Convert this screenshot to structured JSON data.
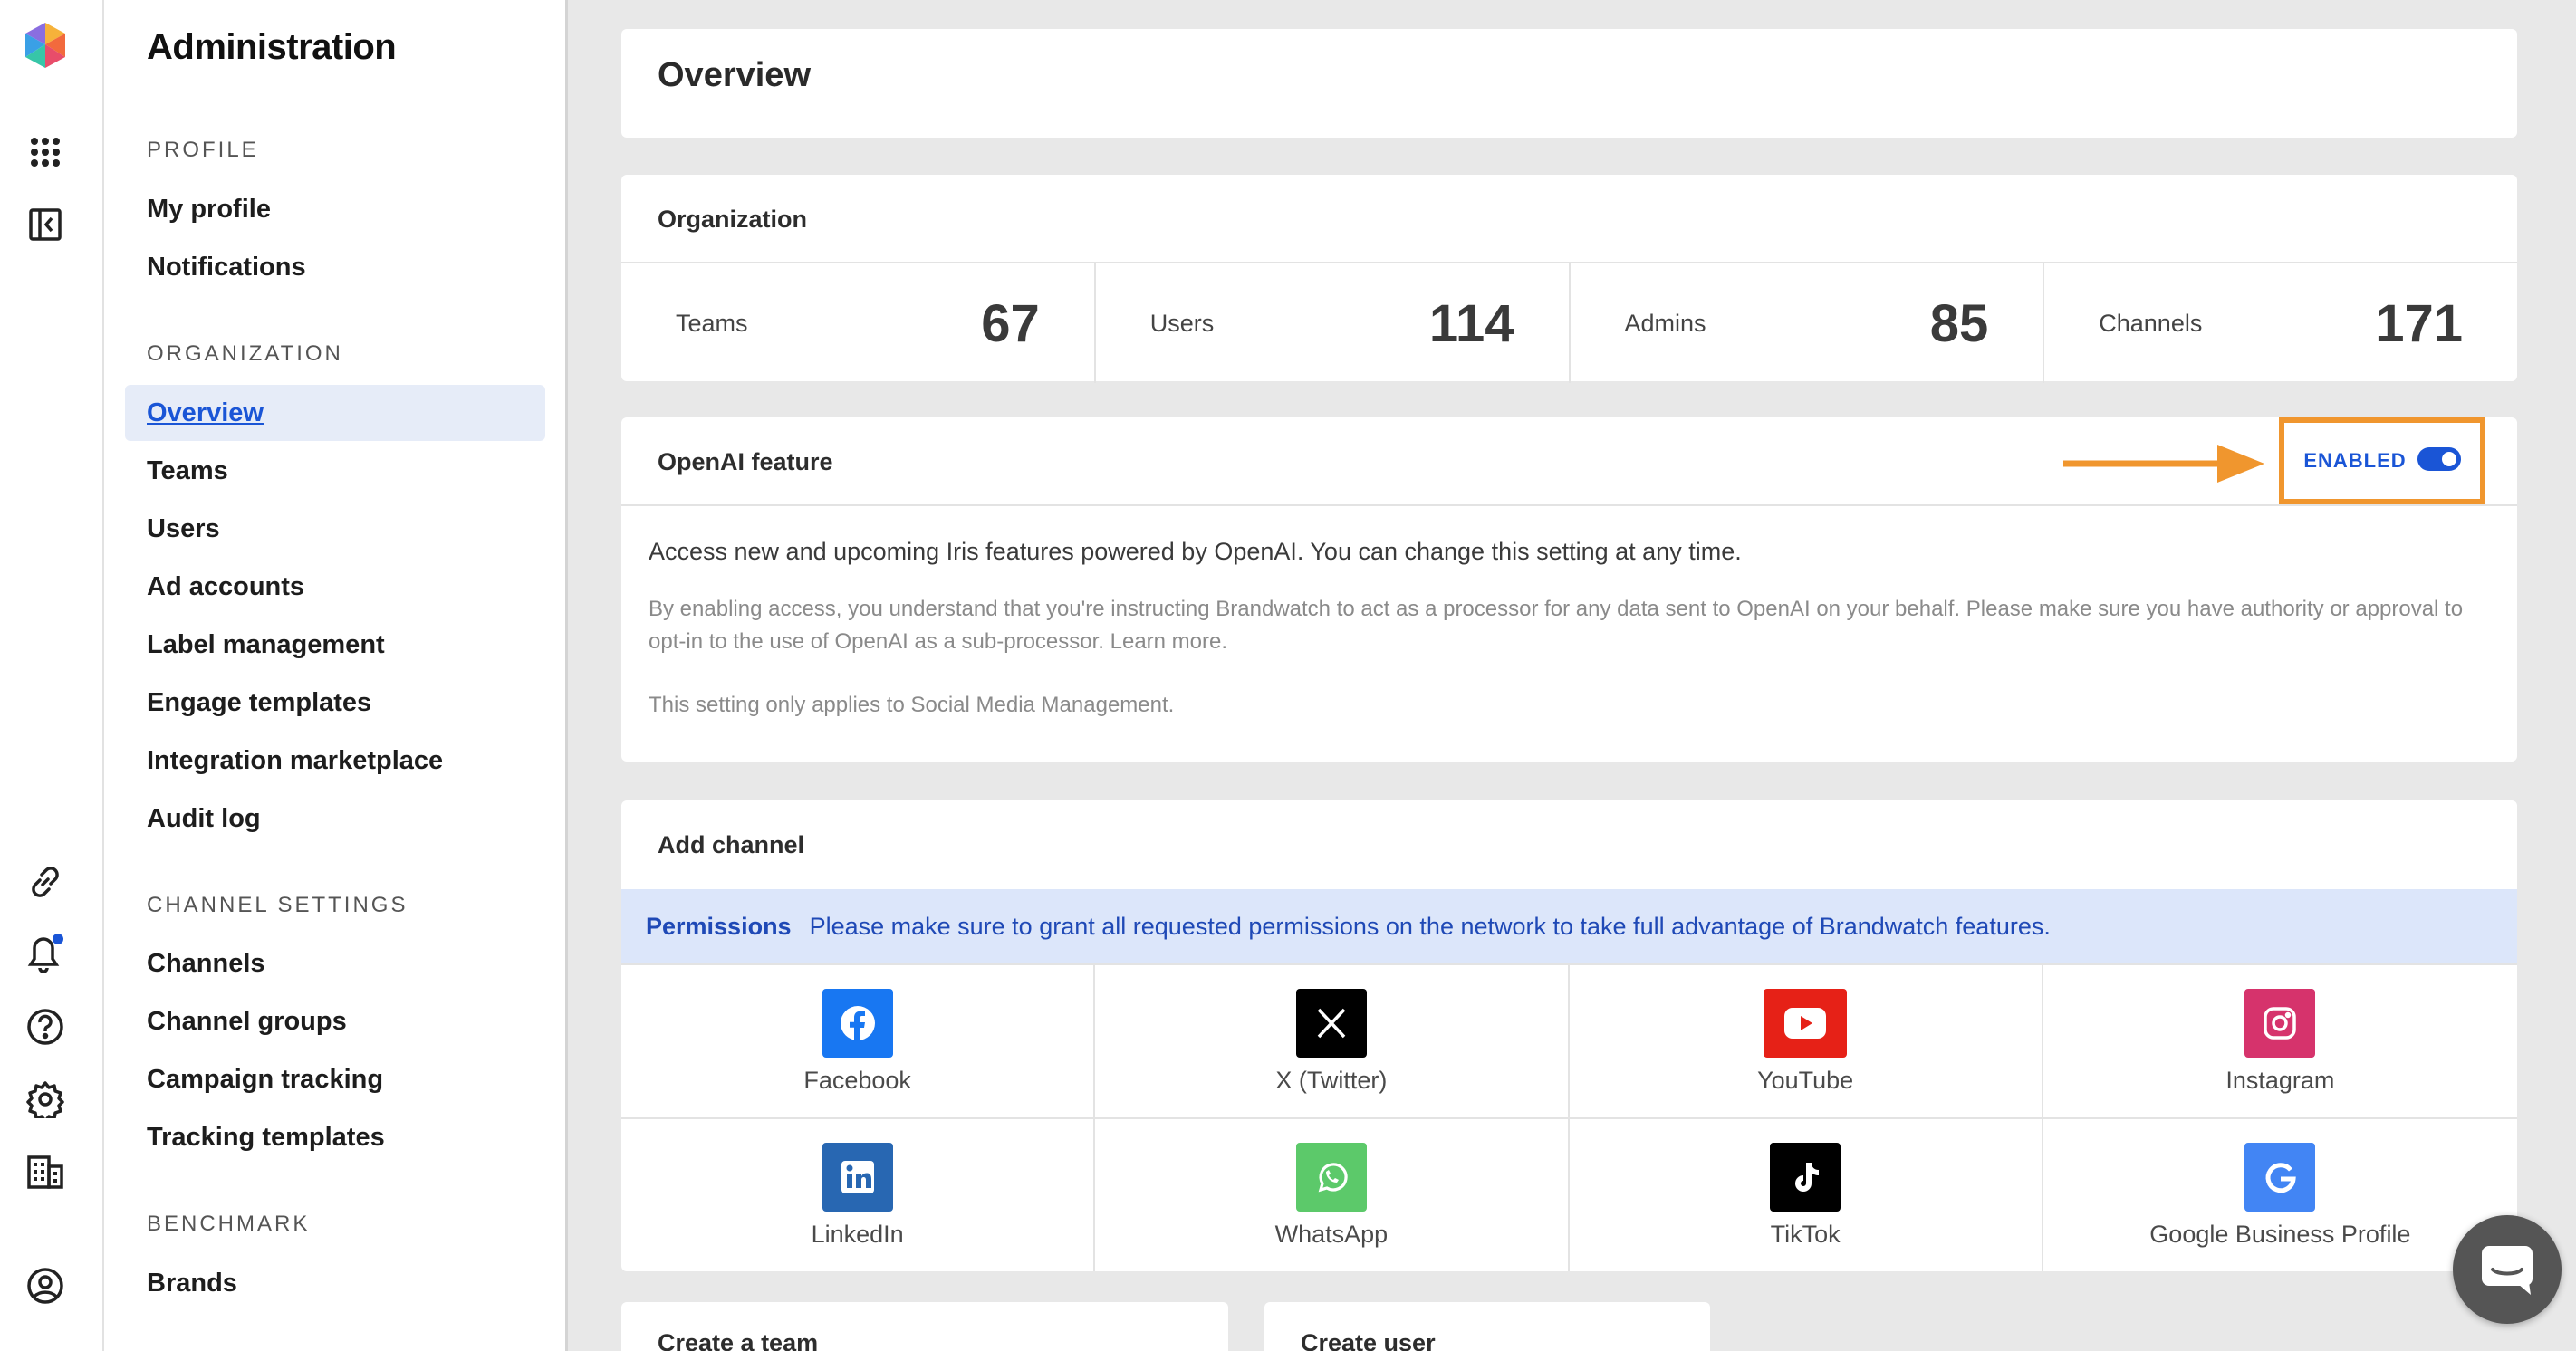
{
  "sidebar": {
    "title": "Administration",
    "sections": {
      "profile": "PROFILE",
      "organization": "ORGANIZATION",
      "channel_settings": "CHANNEL SETTINGS",
      "benchmark": "BENCHMARK"
    },
    "profile_items": [
      "My profile",
      "Notifications"
    ],
    "organization_items": [
      "Overview",
      "Teams",
      "Users",
      "Ad accounts",
      "Label management",
      "Engage templates",
      "Integration marketplace",
      "Audit log"
    ],
    "channel_items": [
      "Channels",
      "Channel groups",
      "Campaign tracking",
      "Tracking templates"
    ],
    "benchmark_items": [
      "Brands"
    ],
    "active_item": "Overview"
  },
  "rail_icons": [
    "logo-icon",
    "apps-grid-icon",
    "collapse-sidebar-icon",
    "link-icon",
    "bell-icon",
    "help-icon",
    "gear-icon",
    "building-icon",
    "account-icon"
  ],
  "overview": {
    "title": "Overview"
  },
  "organization": {
    "title": "Organization",
    "stats": [
      {
        "label": "Teams",
        "value": "67"
      },
      {
        "label": "Users",
        "value": "114"
      },
      {
        "label": "Admins",
        "value": "85"
      },
      {
        "label": "Channels",
        "value": "171"
      }
    ]
  },
  "openai": {
    "title": "OpenAI feature",
    "toggle_label": "ENABLED",
    "enabled": true,
    "description": "Access new and upcoming Iris features powered by OpenAI. You can change this setting at any time.",
    "fine_print_1": "By enabling access, you understand that you're instructing Brandwatch to act as a processor for any data sent to OpenAI on your behalf. Please make sure you have authority or approval to opt-in to the use of OpenAI as a sub-processor. Learn more.",
    "fine_print_2": "This setting only applies to Social Media Management."
  },
  "add_channel": {
    "title": "Add channel",
    "permissions_label": "Permissions",
    "permissions_text": "Please make sure to grant all requested permissions on the network to take full advantage of Brandwatch features.",
    "networks": [
      {
        "label": "Facebook",
        "icon": "facebook-icon",
        "color": "#1877f2"
      },
      {
        "label": "X (Twitter)",
        "icon": "x-twitter-icon",
        "color": "#000000"
      },
      {
        "label": "YouTube",
        "icon": "youtube-icon",
        "color": "#e62117"
      },
      {
        "label": "Instagram",
        "icon": "instagram-icon",
        "color": "#d6336c"
      },
      {
        "label": "LinkedIn",
        "icon": "linkedin-icon",
        "color": "#2867b2"
      },
      {
        "label": "WhatsApp",
        "icon": "whatsapp-icon",
        "color": "#5cc96a"
      },
      {
        "label": "TikTok",
        "icon": "tiktok-icon",
        "color": "#000000"
      },
      {
        "label": "Google Business Profile",
        "icon": "google-icon",
        "color": "#4285f4"
      }
    ]
  },
  "bottom_cards": [
    "Create a team",
    "Create user"
  ],
  "colors": {
    "accent": "#1a55d6",
    "highlight": "#f0962e",
    "permissions_bg": "#dce6fa"
  }
}
